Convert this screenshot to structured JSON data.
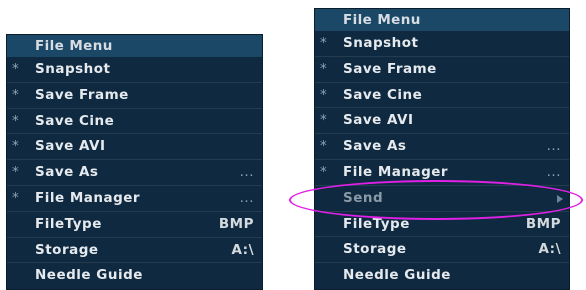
{
  "left_menu": {
    "title": "File Menu",
    "items": [
      {
        "star": "*",
        "label": "Snapshot",
        "value": ""
      },
      {
        "star": "*",
        "label": "Save Frame",
        "value": ""
      },
      {
        "star": "*",
        "label": "Save Cine",
        "value": ""
      },
      {
        "star": "*",
        "label": "Save AVI",
        "value": ""
      },
      {
        "star": "*",
        "label": "Save As",
        "value": "..."
      },
      {
        "star": "*",
        "label": "File Manager",
        "value": "..."
      },
      {
        "star": "",
        "label": "FileType",
        "value": "BMP"
      },
      {
        "star": "",
        "label": "Storage",
        "value": "A:\\"
      },
      {
        "star": "",
        "label": "Needle Guide",
        "value": ""
      }
    ]
  },
  "right_menu": {
    "title": "File Menu",
    "items": [
      {
        "star": "*",
        "label": "Snapshot",
        "value": ""
      },
      {
        "star": "*",
        "label": "Save Frame",
        "value": ""
      },
      {
        "star": "*",
        "label": "Save Cine",
        "value": ""
      },
      {
        "star": "*",
        "label": "Save AVI",
        "value": ""
      },
      {
        "star": "*",
        "label": "Save As",
        "value": "..."
      },
      {
        "star": "*",
        "label": "File Manager",
        "value": "..."
      },
      {
        "star": "",
        "label": "Send",
        "value": "",
        "submenu": true,
        "disabled": true
      },
      {
        "star": "",
        "label": "FileType",
        "value": "BMP"
      },
      {
        "star": "",
        "label": "Storage",
        "value": "A:\\"
      },
      {
        "star": "",
        "label": "Needle Guide",
        "value": ""
      }
    ]
  },
  "annotation": {
    "color": "#e020e6",
    "target": "Send"
  }
}
